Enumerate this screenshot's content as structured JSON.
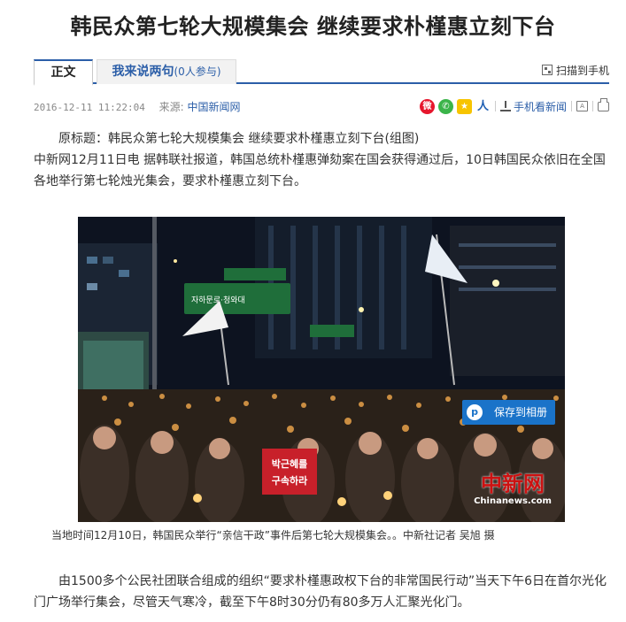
{
  "article": {
    "title": "韩民众第七轮大规模集会  继续要求朴槿惠立刻下台",
    "tabs": {
      "main": "正文",
      "comment": "我来说两句",
      "comment_count": "(0人参与)"
    },
    "scan_mobile": "扫描到手机",
    "date": "2016-12-11  11:22:04",
    "source_label": "来源:",
    "source": "中国新闻网",
    "share_icons": [
      "weibo-icon",
      "wechat-icon",
      "qzone-icon",
      "renren-icon"
    ],
    "mobile_news": "手机看新闻",
    "original_title": "原标题：韩民众第七轮大规模集会  继续要求朴槿惠立刻下台(组图)",
    "lead": "中新网12月11日电    据韩联社报道，韩国总统朴槿惠弹劾案在国会获得通过后，10日韩国民众依旧在全国各地举行第七轮烛光集会，要求朴槿惠立刻下台。",
    "photo": {
      "save_button": "保存到相册",
      "save_logo": "p",
      "sign_line1": "박근혜를",
      "sign_line2": "구속하라",
      "overhead_sign": "자하문로·청와대",
      "watermark_cn": "中新网",
      "watermark_en": "Chinanews.com",
      "caption": "当地时间12月10日，韩国民众举行“亲信干政”事件后第七轮大规模集会。。中新社记者  吴旭  摄"
    },
    "body_para": "由1500多个公民社团联合组成的组织“要求朴槿惠政权下台的非常国民行动”当天下午6日在首尔光化门广场举行集会，尽管天气寒冷，截至下午8时30分仍有80多万人汇聚光化门。"
  }
}
